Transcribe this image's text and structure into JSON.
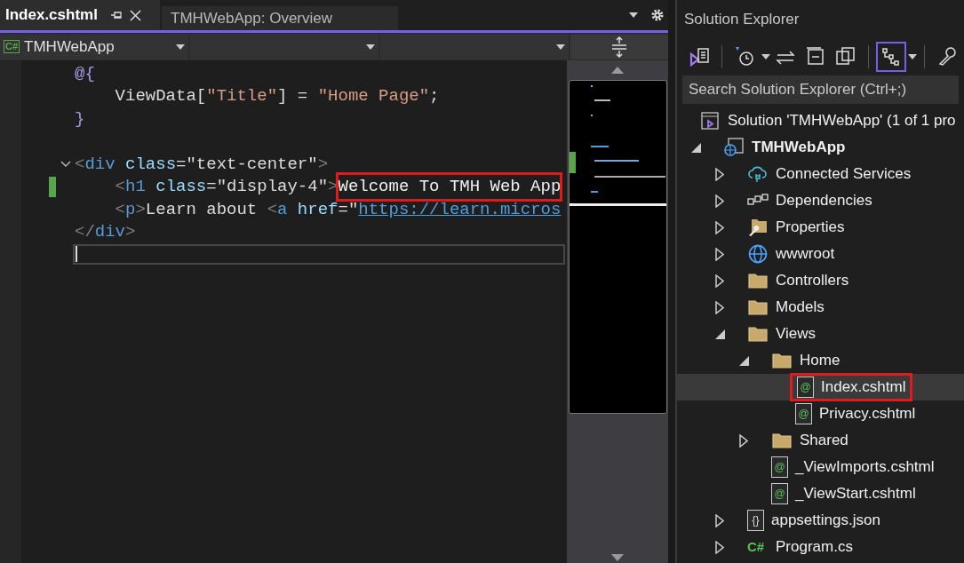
{
  "editor": {
    "tabs": [
      {
        "label": "Index.cshtml",
        "selected": true
      },
      {
        "label": "TMHWebApp: Overview",
        "selected": false
      }
    ],
    "scope": {
      "badge": "C#",
      "value": "TMHWebApp"
    },
    "lines": [
      {
        "kind": "code",
        "modified": false,
        "tokens": [
          {
            "kind": "razor",
            "text": "@{"
          }
        ]
      },
      {
        "kind": "code",
        "modified": false,
        "tokens": [
          {
            "kind": "plain",
            "text": "    ViewData["
          },
          {
            "kind": "string",
            "text": "\"Title\""
          },
          {
            "kind": "plain",
            "text": "] = "
          },
          {
            "kind": "string",
            "text": "\"Home Page\""
          },
          {
            "kind": "plain",
            "text": ";"
          }
        ]
      },
      {
        "kind": "code",
        "modified": false,
        "tokens": [
          {
            "kind": "razor",
            "text": "}"
          }
        ]
      },
      {
        "kind": "blank",
        "modified": false
      },
      {
        "kind": "code",
        "modified": false,
        "expanded": true,
        "tokens": [
          {
            "kind": "delim",
            "text": "<"
          },
          {
            "kind": "tag",
            "text": "div"
          },
          {
            "kind": "attr",
            "text": " class"
          },
          {
            "kind": "plain",
            "text": "=\"text-center\""
          },
          {
            "kind": "delim",
            "text": ">"
          }
        ]
      },
      {
        "kind": "code",
        "modified": true,
        "tokens": [
          {
            "kind": "delim",
            "text": "    <"
          },
          {
            "kind": "tag",
            "text": "h1"
          },
          {
            "kind": "attr",
            "text": " class"
          },
          {
            "kind": "plain",
            "text": "=\"display-4\""
          },
          {
            "kind": "delim",
            "text": ">"
          },
          {
            "kind": "highlight",
            "text": "Welcome To TMH Web App"
          }
        ]
      },
      {
        "kind": "code",
        "modified": false,
        "tokens": [
          {
            "kind": "delim",
            "text": "    <"
          },
          {
            "kind": "tag",
            "text": "p"
          },
          {
            "kind": "delim",
            "text": ">"
          },
          {
            "kind": "plain",
            "text": "Learn about "
          },
          {
            "kind": "delim",
            "text": "<"
          },
          {
            "kind": "tag",
            "text": "a"
          },
          {
            "kind": "attr",
            "text": " href"
          },
          {
            "kind": "plain",
            "text": "=\""
          },
          {
            "kind": "link",
            "text": "https://learn.micros"
          }
        ]
      },
      {
        "kind": "code",
        "modified": false,
        "tokens": [
          {
            "kind": "delim",
            "text": "</"
          },
          {
            "kind": "tag",
            "text": "div"
          },
          {
            "kind": "delim",
            "text": ">"
          }
        ]
      },
      {
        "kind": "current",
        "modified": false
      }
    ]
  },
  "solution_explorer": {
    "title": "Solution Explorer",
    "toolbar": [
      {
        "kind": "switch-views",
        "selected": false
      },
      {
        "kind": "pending-changes",
        "selected": false
      },
      {
        "kind": "sync",
        "selected": false
      },
      {
        "kind": "collapse-all",
        "selected": false
      },
      {
        "kind": "show-all",
        "selected": false
      },
      {
        "kind": "tree-view",
        "selected": true
      },
      {
        "kind": "properties",
        "selected": false
      }
    ],
    "search": {
      "placeholder": "Search Solution Explorer (Ctrl+;)"
    },
    "tree": [
      {
        "label": "Solution 'TMHWebApp' (1 of 1 pro",
        "kind": "solution",
        "bold": false,
        "selected": false,
        "highlighted": false,
        "children": [
          {
            "label": "TMHWebApp",
            "kind": "web-project",
            "bold": true,
            "selected": false,
            "highlighted": false,
            "expanded": true,
            "children": [
              {
                "label": "Connected Services",
                "kind": "cloud",
                "bold": false,
                "selected": false,
                "highlighted": false,
                "expanded": false
              },
              {
                "label": "Dependencies",
                "kind": "dependencies",
                "bold": false,
                "selected": false,
                "highlighted": false,
                "expanded": false
              },
              {
                "label": "Properties",
                "kind": "properties",
                "bold": false,
                "selected": false,
                "highlighted": false,
                "expanded": false
              },
              {
                "label": "wwwroot",
                "kind": "globe",
                "bold": false,
                "selected": false,
                "highlighted": false,
                "expanded": false
              },
              {
                "label": "Controllers",
                "kind": "folder",
                "bold": false,
                "selected": false,
                "highlighted": false,
                "expanded": false
              },
              {
                "label": "Models",
                "kind": "folder",
                "bold": false,
                "selected": false,
                "highlighted": false,
                "expanded": false
              },
              {
                "label": "Views",
                "kind": "folder",
                "bold": false,
                "selected": false,
                "highlighted": false,
                "expanded": true,
                "children": [
                  {
                    "label": "Home",
                    "kind": "folder",
                    "bold": false,
                    "selected": false,
                    "highlighted": false,
                    "expanded": true,
                    "children": [
                      {
                        "label": "Index.cshtml",
                        "kind": "razor",
                        "icon_text": "@",
                        "bold": false,
                        "selected": true,
                        "highlighted": true
                      },
                      {
                        "label": "Privacy.cshtml",
                        "kind": "razor",
                        "icon_text": "@",
                        "bold": false,
                        "selected": false,
                        "highlighted": false
                      }
                    ]
                  },
                  {
                    "label": "Shared",
                    "kind": "folder",
                    "bold": false,
                    "selected": false,
                    "highlighted": false,
                    "expanded": false
                  },
                  {
                    "label": "_ViewImports.cshtml",
                    "kind": "razor",
                    "icon_text": "@",
                    "bold": false,
                    "selected": false,
                    "highlighted": false
                  },
                  {
                    "label": "_ViewStart.cshtml",
                    "kind": "razor",
                    "icon_text": "@",
                    "bold": false,
                    "selected": false,
                    "highlighted": false
                  }
                ]
              },
              {
                "label": "appsettings.json",
                "kind": "json",
                "icon_text": "{}",
                "bold": false,
                "selected": false,
                "highlighted": false,
                "expanded": false
              },
              {
                "label": "Program.cs",
                "kind": "csharp",
                "icon_text": "C#",
                "bold": false,
                "selected": false,
                "highlighted": false,
                "expanded": false
              }
            ]
          }
        ]
      }
    ]
  }
}
